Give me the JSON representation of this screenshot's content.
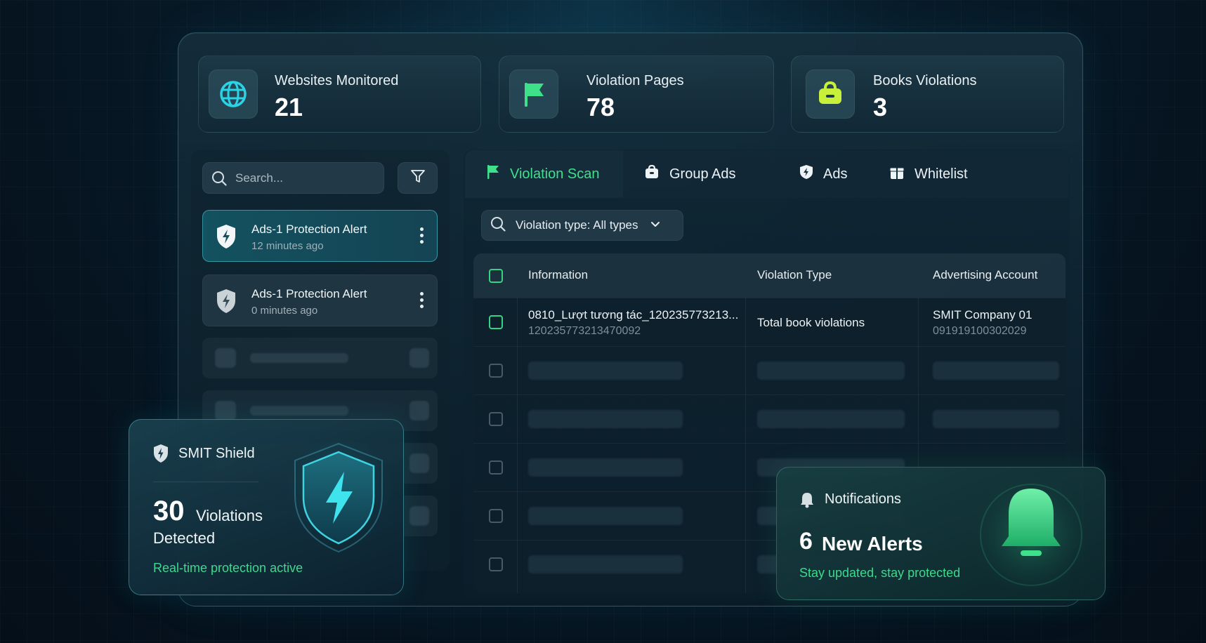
{
  "stats": [
    {
      "label": "Websites Monitored",
      "value": "21",
      "icon": "globe-icon"
    },
    {
      "label": "Violation Pages",
      "value": "78",
      "icon": "flag-icon"
    },
    {
      "label": "Books Violations",
      "value": "3",
      "icon": "book-icon"
    }
  ],
  "sidebar": {
    "search_placeholder": "Search...",
    "alerts": [
      {
        "title": "Ads-1 Protection Alert",
        "time": "12 minutes ago",
        "active": true
      },
      {
        "title": "Ads-1 Protection Alert",
        "time": "0 minutes ago",
        "active": false
      }
    ]
  },
  "tabs": [
    {
      "label": "Violation Scan",
      "icon": "flag-icon",
      "active": true
    },
    {
      "label": "Group Ads",
      "icon": "briefcase-icon",
      "active": false
    },
    {
      "label": "Ads",
      "icon": "shield-icon",
      "active": false
    },
    {
      "label": "Whitelist",
      "icon": "gift-icon",
      "active": false
    }
  ],
  "filter": {
    "label": "Violation type: All types"
  },
  "table": {
    "headers": [
      "Information",
      "Violation Type",
      "Advertising Account"
    ],
    "rows": [
      {
        "info_title": "0810_Lượt tương tác_120235773213...",
        "info_id": "120235773213470092",
        "violation_type": "Total book violations",
        "account_name": "SMIT Company 01",
        "account_id": "091919100302029"
      }
    ]
  },
  "shield_card": {
    "title": "SMIT Shield",
    "count": "30",
    "word1": "Violations",
    "word2": "Detected",
    "tagline": "Real-time protection active"
  },
  "notifications": {
    "title": "Notifications",
    "count": "6",
    "word": "New Alerts",
    "tagline": "Stay updated, stay protected"
  },
  "colors": {
    "accent_green": "#3fe08a",
    "accent_cyan": "#2ad4e6",
    "accent_lime": "#c8f03a"
  }
}
